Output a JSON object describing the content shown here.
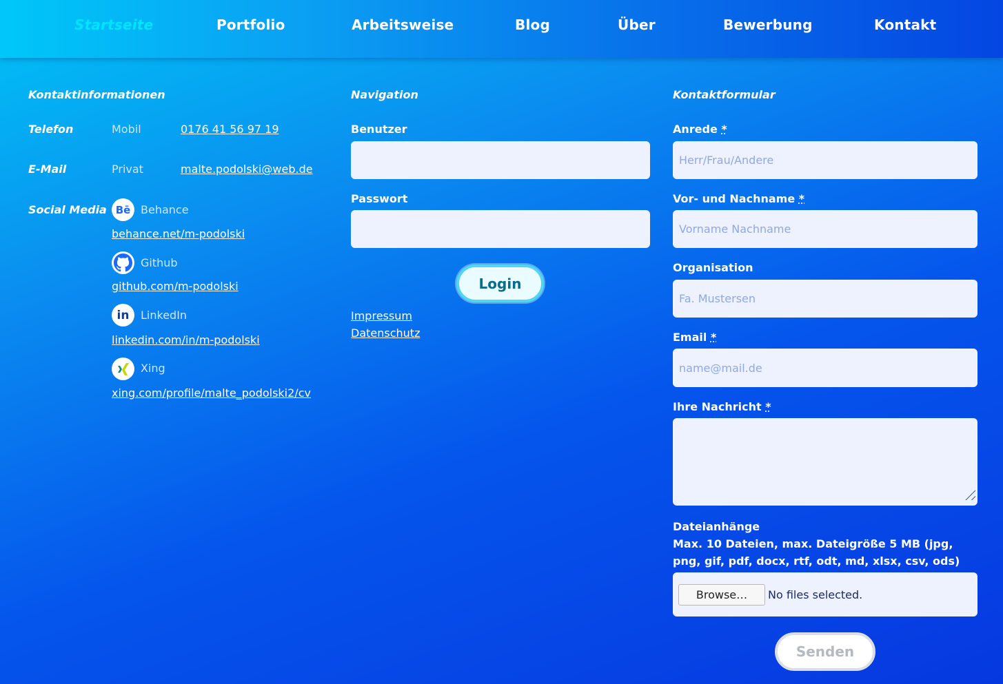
{
  "nav": {
    "items": [
      {
        "label": "Startseite",
        "active": true
      },
      {
        "label": "Portfolio"
      },
      {
        "label": "Arbeitsweise"
      },
      {
        "label": "Blog"
      },
      {
        "label": "Über"
      },
      {
        "label": "Bewerbung"
      },
      {
        "label": "Kontakt"
      }
    ]
  },
  "contact": {
    "title": "Kontaktinformationen",
    "phone": {
      "label": "Telefon",
      "type": "Mobil",
      "value": "0176 41 56 97 19"
    },
    "email": {
      "label": "E-Mail",
      "type": "Privat",
      "value": "malte.podolski@web.de"
    },
    "social": {
      "label": "Social Media",
      "items": [
        {
          "name": "Behance",
          "icon": "behance-icon",
          "url": "behance.net/m-podolski"
        },
        {
          "name": "Github",
          "icon": "github-icon",
          "url": "github.com/m-podolski"
        },
        {
          "name": "LinkedIn",
          "icon": "linkedin-icon",
          "url": "linkedin.com/in/m-podolski"
        },
        {
          "name": "Xing",
          "icon": "xing-icon",
          "url": "xing.com/profile/malte_podolski2/cv"
        }
      ]
    }
  },
  "navigation": {
    "title": "Navigation",
    "user_label": "Benutzer",
    "user_value": "",
    "password_label": "Passwort",
    "password_value": "",
    "login_label": "Login",
    "links": [
      "Impressum",
      "Datenschutz"
    ]
  },
  "form": {
    "title": "Kontaktformular",
    "salutation": {
      "label": "Anrede",
      "required": "*",
      "placeholder": "Herr/Frau/Andere"
    },
    "name": {
      "label": "Vor- und Nachname",
      "required": "*",
      "placeholder": "Vorname Nachname"
    },
    "organisation": {
      "label": "Organisation",
      "placeholder": "Fa. Mustersen"
    },
    "email": {
      "label": "Email",
      "required": "*",
      "placeholder": "name@mail.de"
    },
    "message": {
      "label": "Ihre Nachricht",
      "required": "*",
      "placeholder": ""
    },
    "attachments": {
      "label": "Dateianhänge",
      "note": "Max. 10 Dateien, max. Dateigröße 5 MB (jpg, png, gif, pdf, docx, rtf, odt, md, xlsx, csv, ods)",
      "browse_label": "Browse…",
      "status": "No files selected."
    },
    "send_label": "Senden"
  },
  "colors": {
    "active_nav": "#00e5ff",
    "field_bg": "#eef2ff",
    "login_border": "#4fd6f3"
  }
}
